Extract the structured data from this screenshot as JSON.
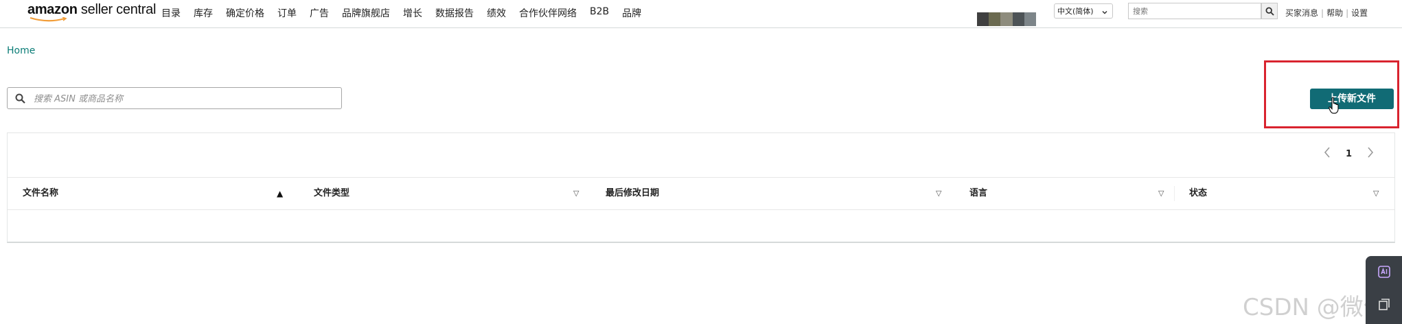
{
  "topbar": {
    "logo_brand": "amazon",
    "logo_rest": " seller central",
    "nav_items": [
      "目录",
      "库存",
      "确定价格",
      "订单",
      "广告",
      "品牌旗舰店",
      "增长",
      "数据报告",
      "绩效",
      "合作伙伴网络",
      "B2B",
      "品牌"
    ],
    "language": "中文(简体)",
    "search_placeholder": "搜索",
    "links": [
      "买家消息",
      "帮助",
      "设置"
    ]
  },
  "breadcrumb": "Home",
  "search": {
    "placeholder": "搜索 ASIN 或商品名称"
  },
  "upload_button": "上传新文件",
  "pagination": {
    "current_page": "1"
  },
  "table": {
    "columns": [
      "文件名称",
      "文件类型",
      "最后修改日期",
      "语言",
      "状态"
    ],
    "rows": []
  },
  "watermark": "CSDN @微信",
  "colors": {
    "accent": "#116b75",
    "breadcrumb": "#0a7c76",
    "highlight": "#d9232e"
  }
}
